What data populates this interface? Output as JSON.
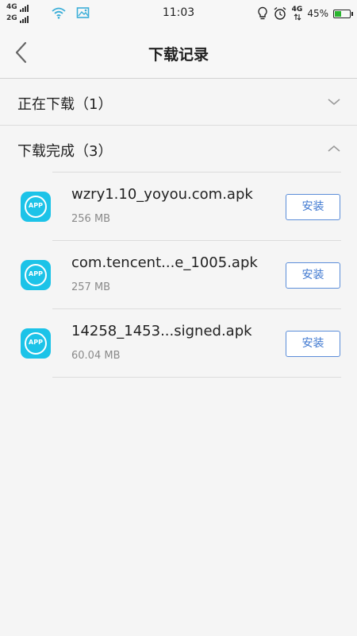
{
  "status_bar": {
    "sim1": "4G",
    "sim2": "2G",
    "time": "11:03",
    "net": "4G",
    "battery": "45%",
    "battery_level": 0.45
  },
  "nav": {
    "title": "下载记录"
  },
  "sections": {
    "downloading": {
      "label": "正在下载（1）"
    },
    "completed": {
      "label": "下载完成（3）"
    }
  },
  "files": [
    {
      "name": "wzry1.10_yoyou.com.apk",
      "size": "256 MB",
      "icon_text": "APP",
      "action": "安装"
    },
    {
      "name": "com.tencent...e_1005.apk",
      "size": "257 MB",
      "icon_text": "APP",
      "action": "安装"
    },
    {
      "name": "14258_1453...signed.apk",
      "size": "60.04 MB",
      "icon_text": "APP",
      "action": "安装"
    }
  ],
  "colors": {
    "accent": "#3f78d0",
    "icon_bg": "#1cc3e8",
    "battery": "#29b52e"
  }
}
